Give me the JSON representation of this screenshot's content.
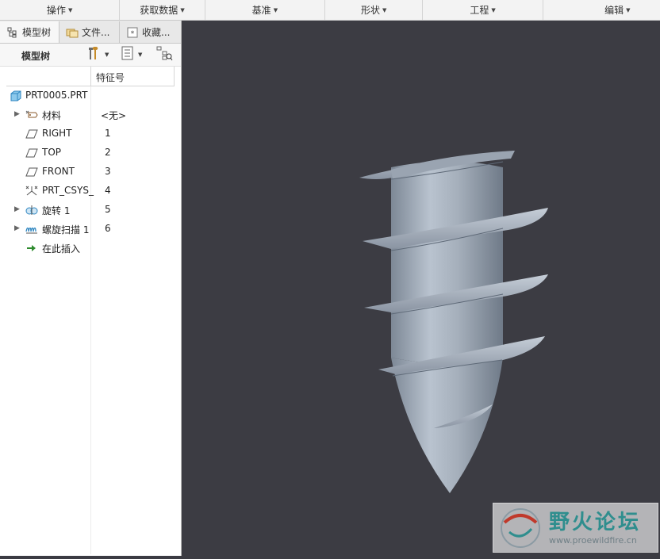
{
  "ribbon": {
    "groups": [
      {
        "label": "操作"
      },
      {
        "label": "获取数据"
      },
      {
        "label": "基准"
      },
      {
        "label": "形状"
      },
      {
        "label": "工程"
      },
      {
        "label": "编辑"
      }
    ]
  },
  "panel": {
    "tabs": [
      {
        "label": "模型树",
        "icon": "model-tree-icon"
      },
      {
        "label": "文件...",
        "icon": "folder-icon"
      },
      {
        "label": "收藏...",
        "icon": "favorites-icon"
      }
    ],
    "toolbar_title": "模型树",
    "column_header": "特征号",
    "tree": [
      {
        "label": "PRT0005.PRT",
        "num": "",
        "icon": "part-icon"
      },
      {
        "label": "材料",
        "num": "<无>",
        "icon": "material-icon"
      },
      {
        "label": "RIGHT",
        "num": "1",
        "icon": "datum-plane-icon"
      },
      {
        "label": "TOP",
        "num": "2",
        "icon": "datum-plane-icon"
      },
      {
        "label": "FRONT",
        "num": "3",
        "icon": "datum-plane-icon"
      },
      {
        "label": "PRT_CSYS_",
        "num": "4",
        "icon": "csys-icon"
      },
      {
        "label": "旋转 1",
        "num": "5",
        "icon": "revolve-icon"
      },
      {
        "label": "螺旋扫描 1",
        "num": "6",
        "icon": "helical-sweep-icon"
      },
      {
        "label": "在此插入",
        "num": "",
        "icon": "insert-here-icon"
      }
    ]
  },
  "watermark": {
    "name": "野火论坛",
    "url": "www.proewildfire.cn"
  },
  "colors": {
    "viewport_bg": "#3c3c43",
    "model": "#a9b3bf",
    "watermark_text": "#2f8e8e"
  }
}
